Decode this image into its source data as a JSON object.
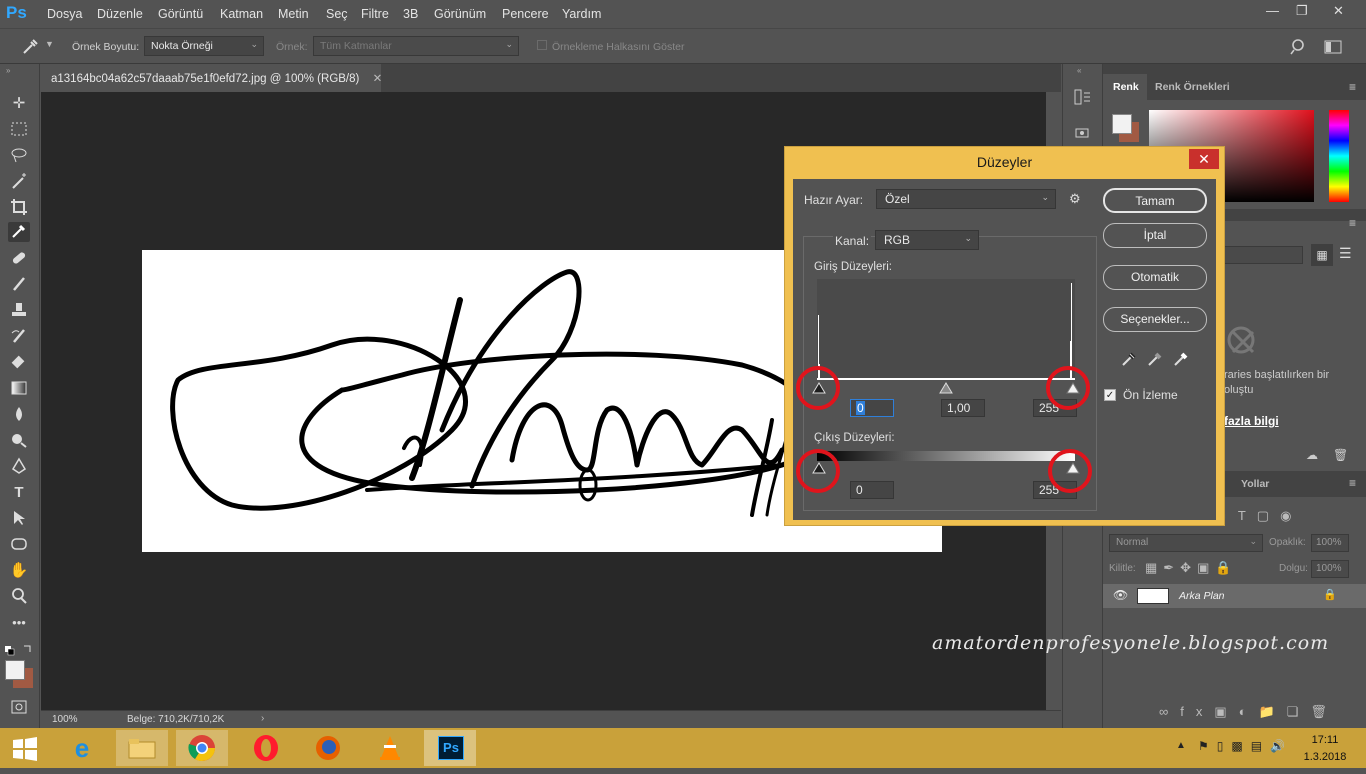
{
  "app": {
    "logo": "Ps"
  },
  "menu": [
    "Dosya",
    "Düzenle",
    "Görüntü",
    "Katman",
    "Metin",
    "Seç",
    "Filtre",
    "3B",
    "Görünüm",
    "Pencere",
    "Yardım"
  ],
  "options": {
    "sample_size_label": "Örnek Boyutu:",
    "sample_size_value": "Nokta Örneği",
    "sample_label": "Örnek:",
    "sample_value": "Tüm Katmanlar",
    "show_ring_label": "Örnekleme Halkasını Göster"
  },
  "document": {
    "tab_title": "a13164bc04a62c57daaab75e1f0efd72.jpg @ 100% (RGB/8)",
    "zoom": "100%",
    "doc_size": "Belge: 710,2K/710,2K"
  },
  "right_panel": {
    "tab_color": "Renk",
    "tab_swatches": "Renk Örnekleri",
    "cc_text_1": "raries başlatılırken bir",
    "cc_text_2": "oluştu",
    "more_info": "fazla bilgi",
    "tab_paths": "Yollar",
    "blend_mode": "Normal",
    "opacity_label": "Opaklık:",
    "opacity_value": "100%",
    "lock_label": "Kilitle:",
    "fill_label": "Dolgu:",
    "fill_value": "100%",
    "layer_name": "Arka Plan"
  },
  "dialog": {
    "title": "Düzeyler",
    "preset_label": "Hazır Ayar:",
    "preset_value": "Özel",
    "channel_label": "Kanal:",
    "channel_value": "RGB",
    "input_levels_label": "Giriş Düzeyleri:",
    "input_black": "0",
    "input_gamma": "1,00",
    "input_white": "255",
    "output_levels_label": "Çıkış Düzeyleri:",
    "output_black": "0",
    "output_white": "255",
    "btn_ok": "Tamam",
    "btn_cancel": "İptal",
    "btn_auto": "Otomatik",
    "btn_options": "Seçenekler...",
    "preview_label": "Ön İzleme",
    "preview_checked": true
  },
  "watermark": "amatordenprofesyonele.blogspot.com",
  "taskbar": {
    "time": "17:11",
    "date": "1.3.2018"
  },
  "colors": {
    "ps_blue": "#31a8ff",
    "dialog_frame": "#f0c050",
    "highlight_red": "#e0141c",
    "taskbar": "#c9a13a"
  }
}
